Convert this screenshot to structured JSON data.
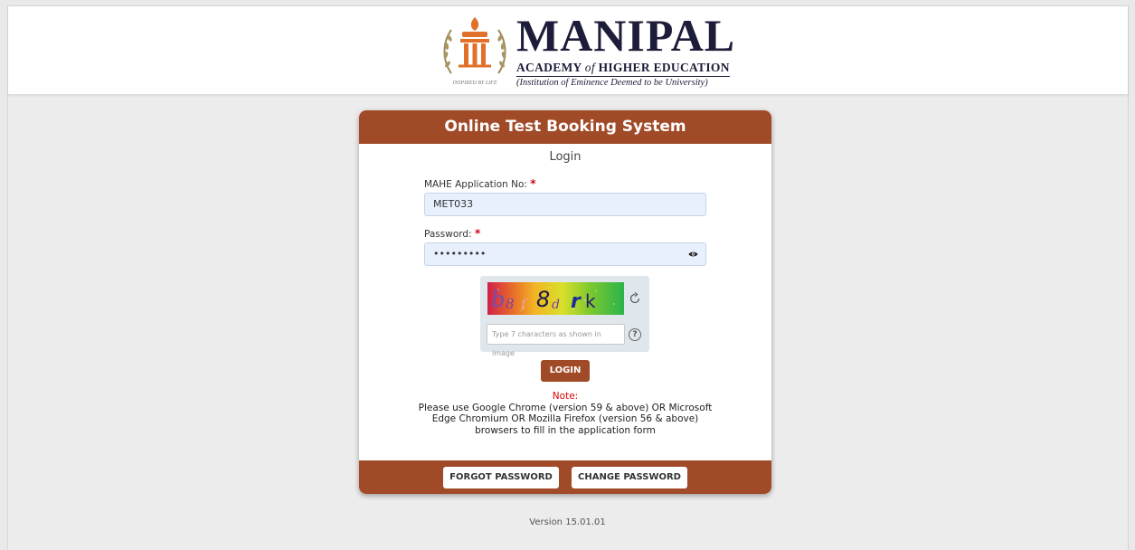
{
  "header": {
    "brand": "MANIPAL",
    "academy_prefix": "ACADEMY",
    "academy_of": "of",
    "academy_suffix": "HIGHER EDUCATION",
    "institution": "(Institution of Eminence Deemed to be University)",
    "emblem_motto": "INSPIRED BY LIFE"
  },
  "card": {
    "title": "Online Test Booking System",
    "login_heading": "Login",
    "application_label": "MAHE Application No:",
    "application_value": "MET033",
    "password_label": "Password:",
    "password_value": "•••••••••",
    "required_mark": "*",
    "captcha_text": "b8f8drk",
    "captcha_placeholder": "Type 7 characters as shown in image",
    "login_button": "LOGIN",
    "note_title": "Note:",
    "note_line1": "Please use Google Chrome (version 59 & above) OR Microsoft",
    "note_line2": "Edge Chromium OR Mozilla Firefox (version 56 & above)",
    "note_line3": "browsers to fill in the application form",
    "forgot_button": "FORGOT PASSWORD",
    "change_button": "CHANGE PASSWORD"
  },
  "footer": {
    "version": "Version 15.01.01"
  },
  "colors": {
    "accent": "#a14a28",
    "input_bg": "#e8f0fe",
    "required": "#d0021b"
  }
}
